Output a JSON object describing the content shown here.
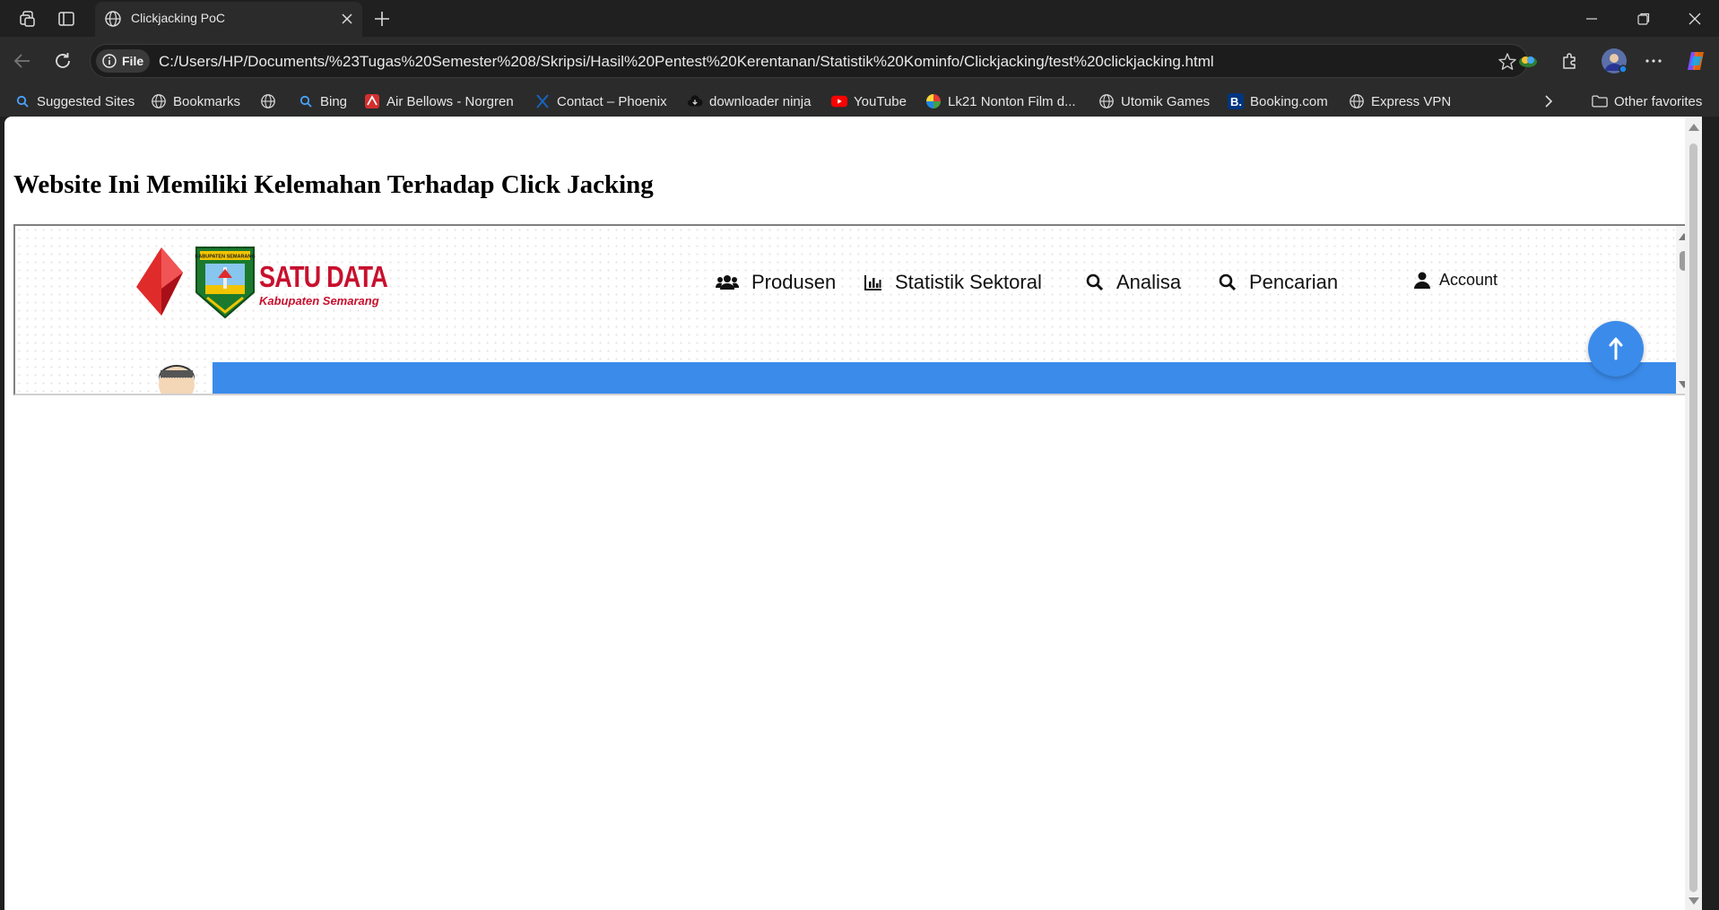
{
  "browser": {
    "tab": {
      "title": "Clickjacking PoC"
    },
    "address_bar": {
      "scheme_label": "File",
      "url": "C:/Users/HP/Documents/%23Tugas%20Semester%208/Skripsi/Hasil%20Pentest%20Kerentanan/Statistik%20Kominfo/Clickjacking/test%20clickjacking.html"
    },
    "bookmarks": [
      {
        "label": "Suggested Sites",
        "icon": "search-icon"
      },
      {
        "label": "Bookmarks",
        "icon": "globe-icon"
      },
      {
        "label": "",
        "icon": "globe-icon"
      },
      {
        "label": "Bing",
        "icon": "search-icon"
      },
      {
        "label": "Air Bellows - Norgren",
        "icon": "norgren-favicon"
      },
      {
        "label": "Contact – Phoenix",
        "icon": "phoenix-favicon"
      },
      {
        "label": "downloader ninja",
        "icon": "cloud-download-icon"
      },
      {
        "label": "YouTube",
        "icon": "youtube-icon"
      },
      {
        "label": "Lk21 Nonton Film d...",
        "icon": "lk21-favicon"
      },
      {
        "label": "Utomik Games",
        "icon": "globe-icon"
      },
      {
        "label": "Booking.com",
        "icon": "booking-favicon"
      },
      {
        "label": "Express VPN",
        "icon": "globe-icon"
      }
    ],
    "other_favorites": "Other favorites"
  },
  "page": {
    "heading": "Website Ini Memiliki Kelemahan Terhadap Click Jacking"
  },
  "framed_site": {
    "logo_title": "SATU DATA",
    "logo_subtitle": "Kabupaten Semarang",
    "seal_text": "KABUPATEN SEMARANG",
    "nav": [
      {
        "label": "Produsen",
        "icon": "users-icon"
      },
      {
        "label": "Statistik Sektoral",
        "icon": "bar-chart-icon"
      },
      {
        "label": "Analisa",
        "icon": "search-icon"
      },
      {
        "label": "Pencarian",
        "icon": "search-icon"
      },
      {
        "label": "Account",
        "icon": "user-icon"
      }
    ],
    "colors": {
      "accent": "#3b8beb",
      "brand_red": "#c8102e"
    }
  }
}
